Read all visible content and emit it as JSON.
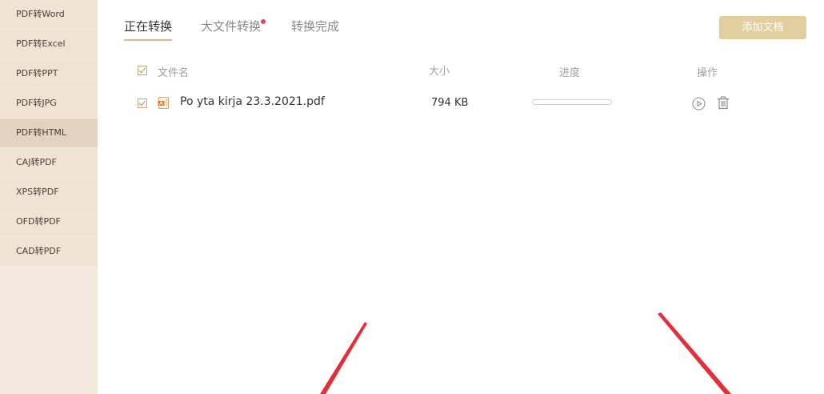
{
  "sidebar": {
    "items": [
      {
        "label": "PDF转Word"
      },
      {
        "label": "PDF转Excel"
      },
      {
        "label": "PDF转PPT"
      },
      {
        "label": "PDF转JPG"
      },
      {
        "label": "PDF转HTML"
      },
      {
        "label": "CAJ转PDF"
      },
      {
        "label": "XPS转PDF"
      },
      {
        "label": "OFD转PDF"
      },
      {
        "label": "CAD转PDF"
      }
    ],
    "active_index": 4
  },
  "tabs": [
    {
      "label": "正在转换"
    },
    {
      "label": "大文件转换"
    },
    {
      "label": "转换完成"
    }
  ],
  "add_button": {
    "label": "添加文档"
  },
  "table": {
    "headers": {
      "filename": "文件名",
      "size": "大小",
      "progress": "进度",
      "actions": "操作"
    },
    "rows": [
      {
        "filename": "Po yta kirja 23.3.2021.pdf",
        "size": "794 KB",
        "progress": 0
      }
    ]
  },
  "colors": {
    "accent": "#d9b98d",
    "button": "#e2cd9f",
    "badge_dot": "#e0455c",
    "decor_line": "#e0303a"
  }
}
